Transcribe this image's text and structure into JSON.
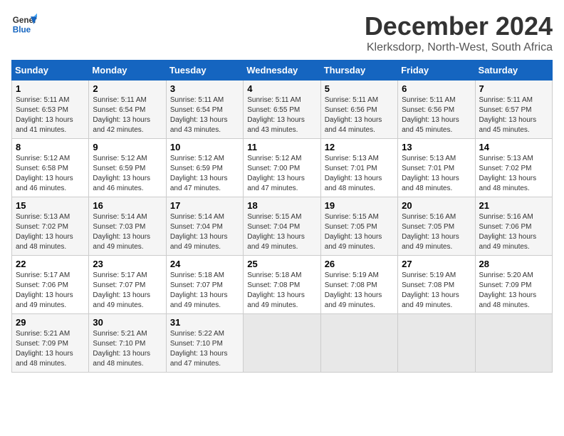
{
  "logo": {
    "line1": "General",
    "line2": "Blue"
  },
  "title": "December 2024",
  "subtitle": "Klerksdorp, North-West, South Africa",
  "weekdays": [
    "Sunday",
    "Monday",
    "Tuesday",
    "Wednesday",
    "Thursday",
    "Friday",
    "Saturday"
  ],
  "weeks": [
    [
      {
        "day": "1",
        "sunrise": "5:11 AM",
        "sunset": "6:53 PM",
        "daylight": "13 hours and 41 minutes."
      },
      {
        "day": "2",
        "sunrise": "5:11 AM",
        "sunset": "6:54 PM",
        "daylight": "13 hours and 42 minutes."
      },
      {
        "day": "3",
        "sunrise": "5:11 AM",
        "sunset": "6:54 PM",
        "daylight": "13 hours and 43 minutes."
      },
      {
        "day": "4",
        "sunrise": "5:11 AM",
        "sunset": "6:55 PM",
        "daylight": "13 hours and 43 minutes."
      },
      {
        "day": "5",
        "sunrise": "5:11 AM",
        "sunset": "6:56 PM",
        "daylight": "13 hours and 44 minutes."
      },
      {
        "day": "6",
        "sunrise": "5:11 AM",
        "sunset": "6:56 PM",
        "daylight": "13 hours and 45 minutes."
      },
      {
        "day": "7",
        "sunrise": "5:11 AM",
        "sunset": "6:57 PM",
        "daylight": "13 hours and 45 minutes."
      }
    ],
    [
      {
        "day": "8",
        "sunrise": "5:12 AM",
        "sunset": "6:58 PM",
        "daylight": "13 hours and 46 minutes."
      },
      {
        "day": "9",
        "sunrise": "5:12 AM",
        "sunset": "6:59 PM",
        "daylight": "13 hours and 46 minutes."
      },
      {
        "day": "10",
        "sunrise": "5:12 AM",
        "sunset": "6:59 PM",
        "daylight": "13 hours and 47 minutes."
      },
      {
        "day": "11",
        "sunrise": "5:12 AM",
        "sunset": "7:00 PM",
        "daylight": "13 hours and 47 minutes."
      },
      {
        "day": "12",
        "sunrise": "5:13 AM",
        "sunset": "7:01 PM",
        "daylight": "13 hours and 48 minutes."
      },
      {
        "day": "13",
        "sunrise": "5:13 AM",
        "sunset": "7:01 PM",
        "daylight": "13 hours and 48 minutes."
      },
      {
        "day": "14",
        "sunrise": "5:13 AM",
        "sunset": "7:02 PM",
        "daylight": "13 hours and 48 minutes."
      }
    ],
    [
      {
        "day": "15",
        "sunrise": "5:13 AM",
        "sunset": "7:02 PM",
        "daylight": "13 hours and 48 minutes."
      },
      {
        "day": "16",
        "sunrise": "5:14 AM",
        "sunset": "7:03 PM",
        "daylight": "13 hours and 49 minutes."
      },
      {
        "day": "17",
        "sunrise": "5:14 AM",
        "sunset": "7:04 PM",
        "daylight": "13 hours and 49 minutes."
      },
      {
        "day": "18",
        "sunrise": "5:15 AM",
        "sunset": "7:04 PM",
        "daylight": "13 hours and 49 minutes."
      },
      {
        "day": "19",
        "sunrise": "5:15 AM",
        "sunset": "7:05 PM",
        "daylight": "13 hours and 49 minutes."
      },
      {
        "day": "20",
        "sunrise": "5:16 AM",
        "sunset": "7:05 PM",
        "daylight": "13 hours and 49 minutes."
      },
      {
        "day": "21",
        "sunrise": "5:16 AM",
        "sunset": "7:06 PM",
        "daylight": "13 hours and 49 minutes."
      }
    ],
    [
      {
        "day": "22",
        "sunrise": "5:17 AM",
        "sunset": "7:06 PM",
        "daylight": "13 hours and 49 minutes."
      },
      {
        "day": "23",
        "sunrise": "5:17 AM",
        "sunset": "7:07 PM",
        "daylight": "13 hours and 49 minutes."
      },
      {
        "day": "24",
        "sunrise": "5:18 AM",
        "sunset": "7:07 PM",
        "daylight": "13 hours and 49 minutes."
      },
      {
        "day": "25",
        "sunrise": "5:18 AM",
        "sunset": "7:08 PM",
        "daylight": "13 hours and 49 minutes."
      },
      {
        "day": "26",
        "sunrise": "5:19 AM",
        "sunset": "7:08 PM",
        "daylight": "13 hours and 49 minutes."
      },
      {
        "day": "27",
        "sunrise": "5:19 AM",
        "sunset": "7:08 PM",
        "daylight": "13 hours and 49 minutes."
      },
      {
        "day": "28",
        "sunrise": "5:20 AM",
        "sunset": "7:09 PM",
        "daylight": "13 hours and 48 minutes."
      }
    ],
    [
      {
        "day": "29",
        "sunrise": "5:21 AM",
        "sunset": "7:09 PM",
        "daylight": "13 hours and 48 minutes."
      },
      {
        "day": "30",
        "sunrise": "5:21 AM",
        "sunset": "7:10 PM",
        "daylight": "13 hours and 48 minutes."
      },
      {
        "day": "31",
        "sunrise": "5:22 AM",
        "sunset": "7:10 PM",
        "daylight": "13 hours and 47 minutes."
      },
      null,
      null,
      null,
      null
    ]
  ],
  "labels": {
    "sunrise": "Sunrise:",
    "sunset": "Sunset:",
    "daylight": "Daylight:"
  }
}
